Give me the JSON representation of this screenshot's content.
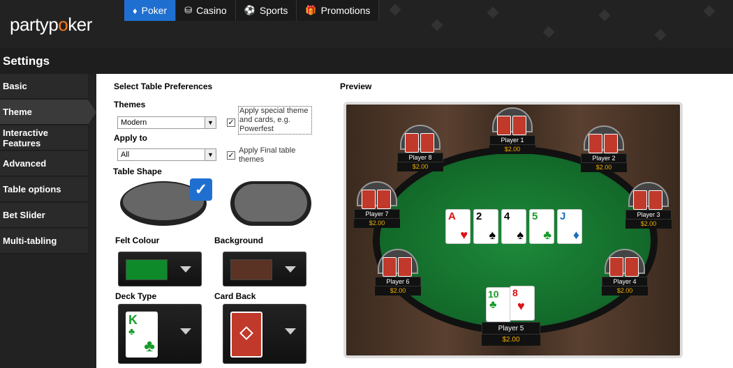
{
  "logo": {
    "party": "party",
    "poker_p": "p",
    "poker_o": "o",
    "poker_ker": "ker"
  },
  "nav": [
    {
      "label": "Poker",
      "icon": "diamond-icon"
    },
    {
      "label": "Casino",
      "icon": "chip-icon"
    },
    {
      "label": "Sports",
      "icon": "ball-icon"
    },
    {
      "label": "Promotions",
      "icon": "gift-icon"
    }
  ],
  "settings": {
    "title": "Settings"
  },
  "sidebar": {
    "items": [
      {
        "label": "Basic"
      },
      {
        "label": "Theme"
      },
      {
        "label": "Interactive Features"
      },
      {
        "label": "Advanced"
      },
      {
        "label": "Table options"
      },
      {
        "label": "Bet Slider"
      },
      {
        "label": "Multi-tabling"
      }
    ]
  },
  "prefs": {
    "heading": "Select Table Preferences",
    "themes_label": "Themes",
    "themes_value": "Modern",
    "apply_to_label": "Apply to",
    "apply_to_value": "All",
    "special_theme": "Apply special theme and cards, e.g. Powerfest",
    "final_table": "Apply Final table themes",
    "table_shape_label": "Table Shape",
    "felt_label": "Felt Colour",
    "background_label": "Background",
    "deck_label": "Deck Type",
    "cardback_label": "Card Back",
    "deck_rank": "K",
    "deck_suit": "♣"
  },
  "preview": {
    "heading": "Preview",
    "players": [
      {
        "name": "Player 1",
        "stack": "$2.00"
      },
      {
        "name": "Player 2",
        "stack": "$2.00"
      },
      {
        "name": "Player 3",
        "stack": "$2.00"
      },
      {
        "name": "Player 4",
        "stack": "$2.00"
      },
      {
        "name": "Player 5",
        "stack": "$2.00"
      },
      {
        "name": "Player 6",
        "stack": "$2.00"
      },
      {
        "name": "Player 7",
        "stack": "$2.00"
      },
      {
        "name": "Player 8",
        "stack": "$2.00"
      }
    ],
    "board": [
      {
        "rank": "A",
        "suit": "♥"
      },
      {
        "rank": "2",
        "suit": "♠"
      },
      {
        "rank": "4",
        "suit": "♠"
      },
      {
        "rank": "5",
        "suit": "♣"
      },
      {
        "rank": "J",
        "suit": "♦"
      }
    ],
    "hero_cards": [
      {
        "rank": "10",
        "suit": "♣"
      },
      {
        "rank": "8",
        "suit": "♥"
      }
    ]
  },
  "colors": {
    "accent": "#1f6fd1",
    "felt": "#0f8a2a",
    "background": "#5a3324",
    "orange": "#ff7a1a"
  }
}
